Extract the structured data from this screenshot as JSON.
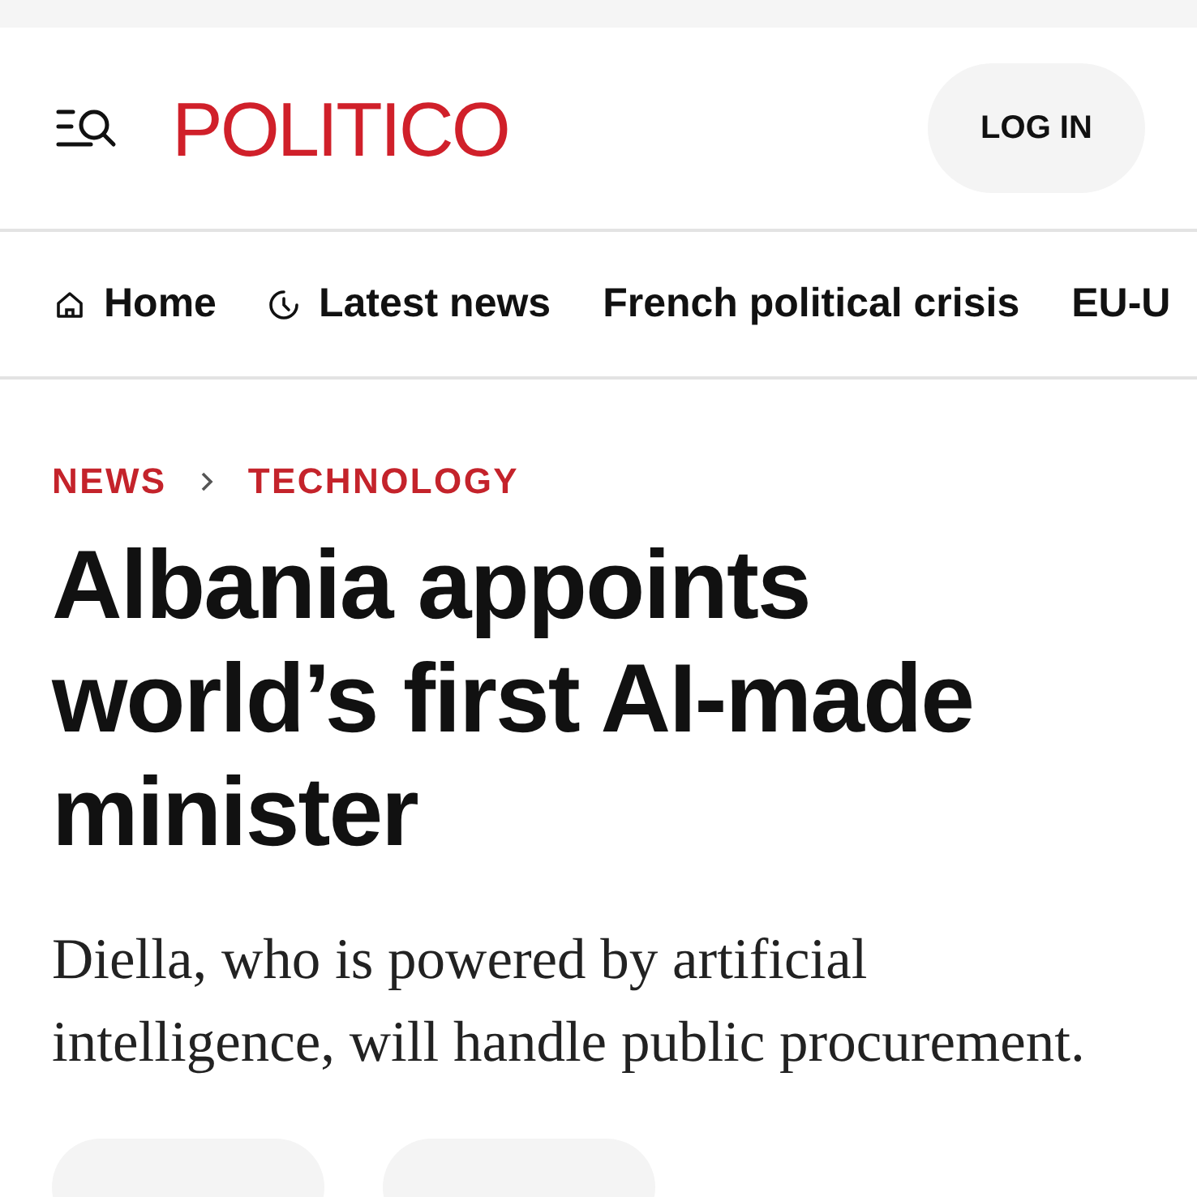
{
  "header": {
    "logo": "POLITICO",
    "login_button": "LOG IN"
  },
  "nav": [
    {
      "label": "Home",
      "kind": "home"
    },
    {
      "label": "Latest news",
      "kind": "latest"
    },
    {
      "label": "French political crisis",
      "kind": "topic"
    },
    {
      "label": "EU-U",
      "kind": "topic"
    }
  ],
  "breadcrumb": [
    "NEWS",
    "TECHNOLOGY"
  ],
  "headline": "Albania appoints world’s first AI-made minister",
  "deck": "Diella, who is powered by artificial intelligence, will handle public procurement.",
  "share_buttons": [
    {
      "kind": "pill"
    },
    {
      "kind": "pill"
    }
  ]
}
